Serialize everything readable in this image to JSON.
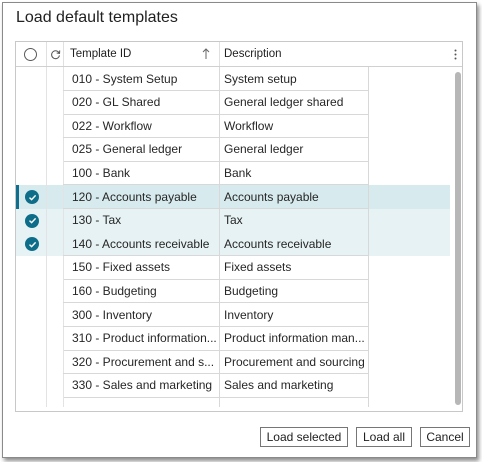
{
  "dialog": {
    "title": "Load default templates"
  },
  "grid": {
    "columns": {
      "template_id": "Template ID",
      "description": "Description"
    },
    "rows": [
      {
        "id": "010 - System Setup",
        "description": "System setup",
        "selected": false
      },
      {
        "id": "020 - GL Shared",
        "description": "General ledger shared",
        "selected": false
      },
      {
        "id": "022 - Workflow",
        "description": "Workflow",
        "selected": false
      },
      {
        "id": "025 - General ledger",
        "description": "General ledger",
        "selected": false
      },
      {
        "id": "100 - Bank",
        "description": "Bank",
        "selected": false
      },
      {
        "id": "120 - Accounts payable",
        "description": "Accounts payable",
        "selected": true,
        "current": true
      },
      {
        "id": "130 - Tax",
        "description": "Tax",
        "selected": true
      },
      {
        "id": "140 - Accounts receivable",
        "description": "Accounts receivable",
        "selected": true
      },
      {
        "id": "150 - Fixed assets",
        "description": "Fixed assets",
        "selected": false
      },
      {
        "id": "160 - Budgeting",
        "description": "Budgeting",
        "selected": false
      },
      {
        "id": "300 - Inventory",
        "description": "Inventory",
        "selected": false
      },
      {
        "id": "310 - Product information...",
        "description": "Product information man...",
        "selected": false
      },
      {
        "id": "320 - Procurement and s...",
        "description": "Procurement and sourcing",
        "selected": false
      },
      {
        "id": "330 - Sales and marketing",
        "description": "Sales and marketing",
        "selected": false
      }
    ]
  },
  "buttons": {
    "load_selected": "Load selected",
    "load_all": "Load all",
    "cancel": "Cancel"
  },
  "colors": {
    "accent": "#0e6e8a",
    "selected_row": "#e6f2f3",
    "current_row": "#d7eaed"
  },
  "icons": {
    "select_all": "radio-circle-icon",
    "refresh": "refresh-icon",
    "sort": "sort-up-arrow-icon",
    "column_options": "vertical-ellipsis-icon",
    "row_selected": "check-circle-icon"
  }
}
